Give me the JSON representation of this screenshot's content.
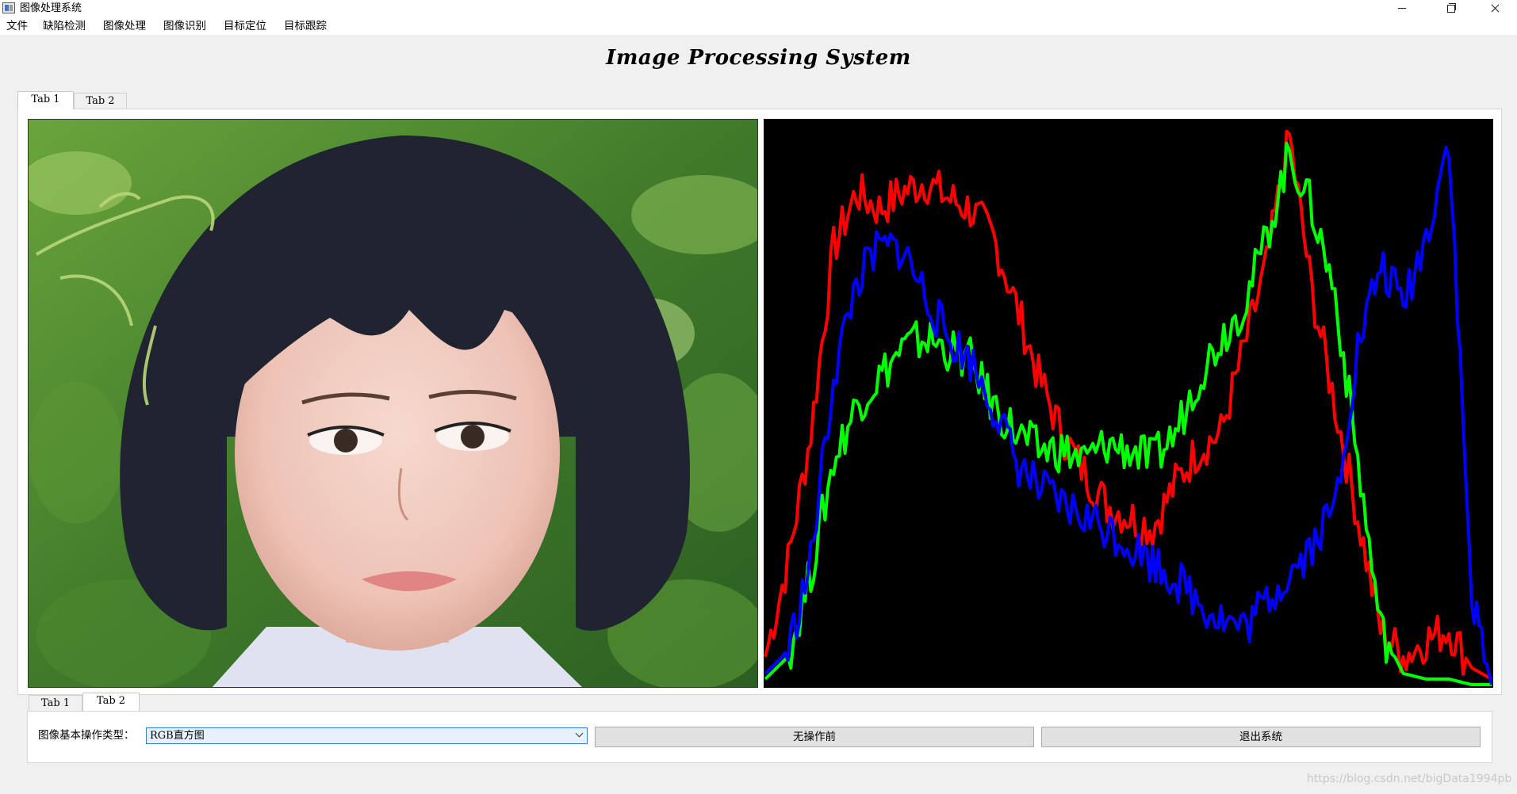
{
  "window": {
    "title": "图像处理系统"
  },
  "menu": [
    "文件",
    "缺陷检测",
    "图像处理",
    "图像识别",
    "目标定位",
    "目标跟踪"
  ],
  "main_title": "Image Processing System",
  "top_tabs": [
    {
      "label": "Tab 1",
      "active": true
    },
    {
      "label": "Tab 2",
      "active": false
    }
  ],
  "bottom_tabs": [
    {
      "label": "Tab 1",
      "active": false
    },
    {
      "label": "Tab 2",
      "active": true
    }
  ],
  "controls": {
    "op_type_label": "图像基本操作类型：",
    "op_type_value": "RGB直方图",
    "undo_button": "无操作前",
    "exit_button": "退出系统"
  },
  "photo": {
    "description_icon": "portrait-photo"
  },
  "watermark": "https://blog.csdn.net/bigData1994pb",
  "colors": {
    "hist_bg": "#000000",
    "red": "#ff0000",
    "green": "#00ff00",
    "blue": "#0000ff"
  },
  "chart_data": {
    "type": "line",
    "title": "",
    "xlabel": "",
    "ylabel": "",
    "x": [
      0,
      8,
      16,
      24,
      32,
      40,
      48,
      56,
      64,
      72,
      80,
      88,
      96,
      104,
      112,
      120,
      128,
      136,
      144,
      152,
      160,
      168,
      176,
      184,
      192,
      200,
      208,
      216,
      224,
      232,
      240,
      248,
      255
    ],
    "xlim": [
      0,
      255
    ],
    "ylim": [
      0,
      1
    ],
    "grid": false,
    "series": [
      {
        "color": "#ff0000",
        "values": [
          0.05,
          0.22,
          0.45,
          0.78,
          0.88,
          0.85,
          0.88,
          0.9,
          0.87,
          0.85,
          0.8,
          0.68,
          0.55,
          0.45,
          0.38,
          0.32,
          0.3,
          0.28,
          0.36,
          0.42,
          0.45,
          0.6,
          0.75,
          0.98,
          0.7,
          0.5,
          0.3,
          0.1,
          0.05,
          0.08,
          0.1,
          0.03,
          0.01
        ]
      },
      {
        "color": "#00ff00",
        "values": [
          0.01,
          0.05,
          0.2,
          0.4,
          0.5,
          0.55,
          0.6,
          0.62,
          0.6,
          0.58,
          0.5,
          0.45,
          0.42,
          0.42,
          0.4,
          0.43,
          0.42,
          0.4,
          0.45,
          0.55,
          0.62,
          0.68,
          0.8,
          0.95,
          0.85,
          0.7,
          0.4,
          0.1,
          0.02,
          0.01,
          0.01,
          0.0,
          0.0
        ]
      },
      {
        "color": "#0000ff",
        "values": [
          0.02,
          0.06,
          0.22,
          0.55,
          0.72,
          0.78,
          0.78,
          0.7,
          0.62,
          0.58,
          0.5,
          0.4,
          0.35,
          0.32,
          0.3,
          0.28,
          0.25,
          0.22,
          0.19,
          0.15,
          0.12,
          0.1,
          0.15,
          0.2,
          0.25,
          0.32,
          0.6,
          0.75,
          0.68,
          0.8,
          0.98,
          0.15,
          0.0
        ]
      }
    ]
  }
}
